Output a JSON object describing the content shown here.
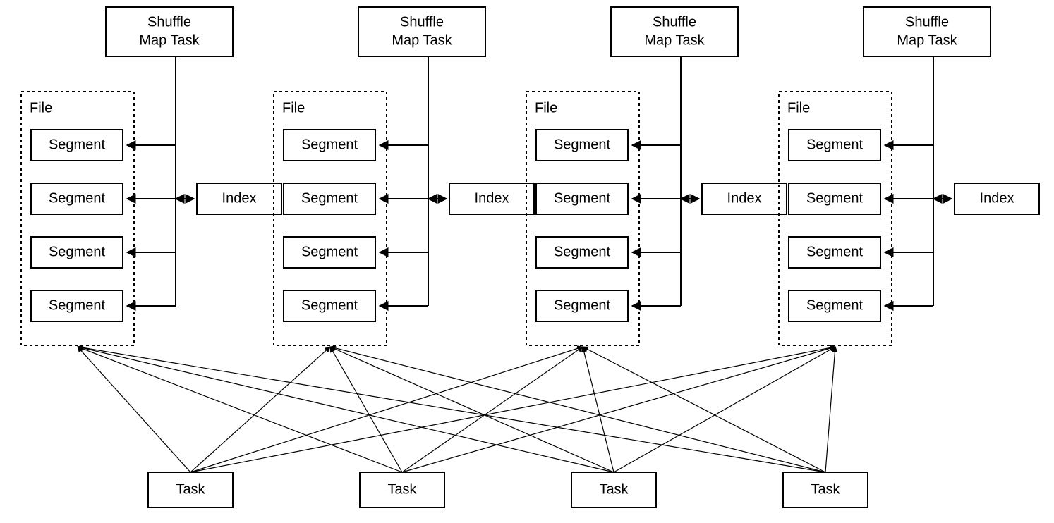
{
  "labels": {
    "shuffle_line1": "Shuffle",
    "shuffle_line2": "Map Task",
    "file": "File",
    "segment": "Segment",
    "index": "Index",
    "task": "Task"
  },
  "layout": {
    "columns": 4,
    "segments_per_file": 4,
    "tasks": 4
  }
}
